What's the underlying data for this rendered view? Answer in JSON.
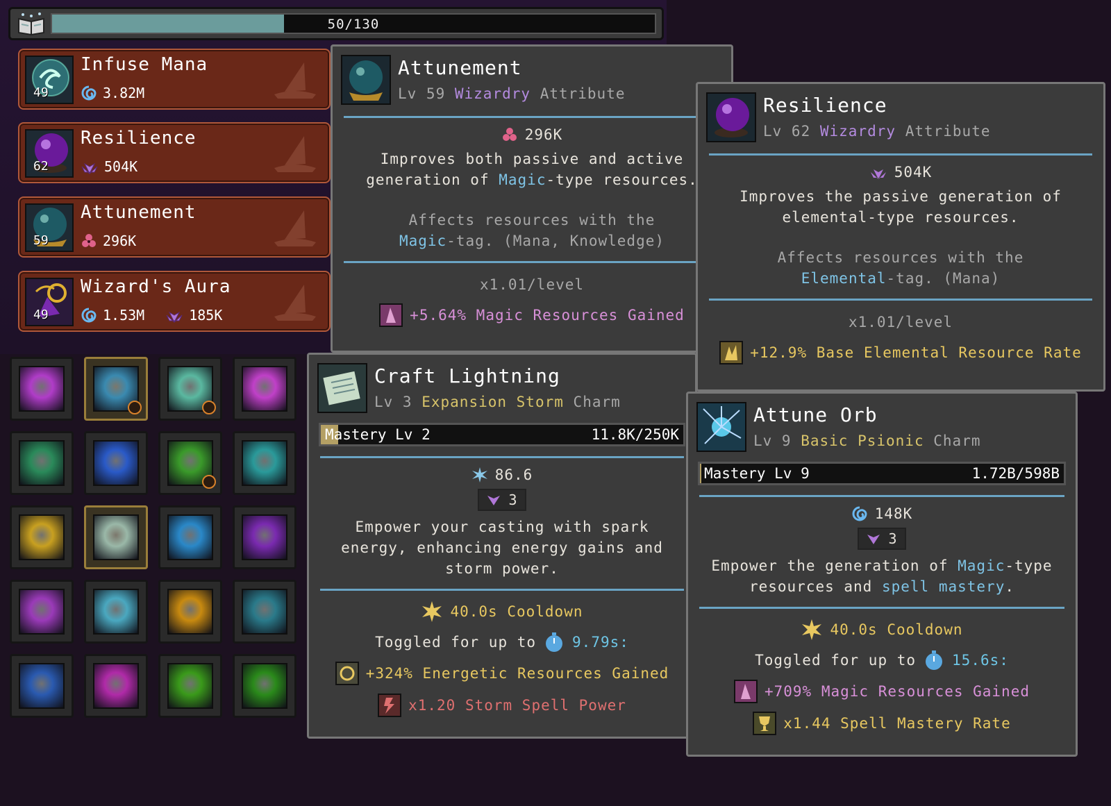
{
  "xp": {
    "current": 50,
    "max": 130,
    "text": "50/130",
    "fill_fraction": 0.385
  },
  "attributes": [
    {
      "name": "Infuse Mana",
      "level": "49",
      "icon": "swirl-orb-icon",
      "costs": [
        {
          "icon": "mana-swirl-icon",
          "value": "3.82M"
        }
      ]
    },
    {
      "name": "Resilience",
      "level": "62",
      "icon": "purple-orb-icon",
      "costs": [
        {
          "icon": "lotus-icon",
          "value": "504K"
        }
      ]
    },
    {
      "name": "Attunement",
      "level": "59",
      "icon": "glass-orb-icon",
      "costs": [
        {
          "icon": "triskelion-icon",
          "value": "296K"
        }
      ]
    },
    {
      "name": "Wizard's Aura",
      "level": "49",
      "icon": "aura-potion-icon",
      "costs": [
        {
          "icon": "mana-swirl-icon",
          "value": "1.53M"
        },
        {
          "icon": "lotus-icon",
          "value": "185K"
        }
      ]
    }
  ],
  "skills": [
    {
      "name": "eye-spell-icon",
      "selected": false,
      "upgrade": false,
      "color": "#b03cc8"
    },
    {
      "name": "attune-orb-icon",
      "selected": true,
      "upgrade": true,
      "color": "#3a8ab0"
    },
    {
      "name": "shout-spell-icon",
      "selected": false,
      "upgrade": true,
      "color": "#5ab8a0"
    },
    {
      "name": "pink-swirl-icon",
      "selected": false,
      "upgrade": false,
      "color": "#c040c8"
    },
    {
      "name": "green-hand-icon",
      "selected": false,
      "upgrade": false,
      "color": "#2a8a5a"
    },
    {
      "name": "blue-galaxy-icon",
      "selected": false,
      "upgrade": false,
      "color": "#2a5ac8"
    },
    {
      "name": "leaf-spell-icon",
      "selected": false,
      "upgrade": true,
      "color": "#3a9a2a"
    },
    {
      "name": "crystal-wall-icon",
      "selected": false,
      "upgrade": false,
      "color": "#2a9a9a"
    },
    {
      "name": "golden-spiral-icon",
      "selected": false,
      "upgrade": false,
      "color": "#c8a020"
    },
    {
      "name": "craft-lightning-icon",
      "selected": true,
      "upgrade": false,
      "color": "#9ab8a8"
    },
    {
      "name": "water-orb-icon",
      "selected": false,
      "upgrade": false,
      "color": "#2a88c8"
    },
    {
      "name": "violet-star-icon",
      "selected": false,
      "upgrade": false,
      "color": "#7a2ab0"
    },
    {
      "name": "rune-glyph-icon",
      "selected": false,
      "upgrade": false,
      "color": "#9a3ab8"
    },
    {
      "name": "ice-hammer-icon",
      "selected": false,
      "upgrade": false,
      "color": "#4aa8c0"
    },
    {
      "name": "gold-ring-icon",
      "selected": false,
      "upgrade": false,
      "color": "#c88a10"
    },
    {
      "name": "vortex-icon",
      "selected": false,
      "upgrade": false,
      "color": "#2a7a8a"
    },
    {
      "name": "rune-cube-icon",
      "selected": false,
      "upgrade": false,
      "color": "#2a5ab0"
    },
    {
      "name": "magenta-bolt-icon",
      "selected": false,
      "upgrade": false,
      "color": "#b02aa8"
    },
    {
      "name": "antler-spirit-icon",
      "selected": false,
      "upgrade": false,
      "color": "#3a9a1a"
    },
    {
      "name": "green-spiral-icon",
      "selected": false,
      "upgrade": false,
      "color": "#2a8a1a"
    }
  ],
  "tip_attunement": {
    "title": "Attunement",
    "sub_lv": "Lv 59",
    "sub_type": "Wizardry",
    "sub_kind": "Attribute",
    "cost": "296K",
    "desc1_a": "Improves both passive and active",
    "desc2_a": "generation of ",
    "desc2_hl": "Magic",
    "desc2_b": "-type resources.",
    "aff1": "Affects resources with the",
    "aff2_hl": "Magic",
    "aff2_b": "-tag. (Mana, Knowledge)",
    "per_level": "x1.01/level",
    "bonus": "+5.64% Magic Resources Gained"
  },
  "tip_resilience": {
    "title": "Resilience",
    "sub_lv": "Lv 62",
    "sub_type": "Wizardry",
    "sub_kind": "Attribute",
    "cost": "504K",
    "desc1": "Improves the passive generation of",
    "desc2": "elemental-type resources.",
    "aff1": "Affects resources with the",
    "aff2_hl": "Elemental",
    "aff2_b": "-tag. (Mana)",
    "per_level": "x1.01/level",
    "bonus": "+12.9% Base Elemental Resource Rate"
  },
  "tip_craft": {
    "title": "Craft Lightning",
    "sub_lv": "Lv 3",
    "sub_type": "Expansion Storm",
    "sub_kind": "Charm",
    "mastery_label": "Mastery Lv 2",
    "mastery_value": "11.8K/250K",
    "mastery_fraction": 0.047,
    "cost": "86.6",
    "slots": "3",
    "desc1": "Empower your casting with spark",
    "desc2": "energy, enhancing energy gains and",
    "desc3": "storm power.",
    "cooldown": "40.0s Cooldown",
    "toggle_label": "Toggled for up to",
    "toggle_value": "9.79s:",
    "bonus1": "+324% Energetic Resources Gained",
    "bonus2": "x1.20 Storm Spell Power"
  },
  "tip_orb": {
    "title": "Attune Orb",
    "sub_lv": "Lv 9",
    "sub_type": "Basic Psionic",
    "sub_kind": "Charm",
    "mastery_label": "Mastery Lv 9",
    "mastery_value": "1.72B/598B",
    "mastery_fraction": 0.003,
    "cost": "148K",
    "slots": "3",
    "desc1_a": "Empower the generation of ",
    "desc1_hl": "Magic",
    "desc1_b": "-type",
    "desc2_a": "resources and ",
    "desc2_hl": "spell mastery",
    "desc2_b": ".",
    "cooldown": "40.0s Cooldown",
    "toggle_label": "Toggled for up to",
    "toggle_value": "15.6s:",
    "bonus1": "+709% Magic Resources Gained",
    "bonus2": "x1.44 Spell Mastery Rate"
  }
}
